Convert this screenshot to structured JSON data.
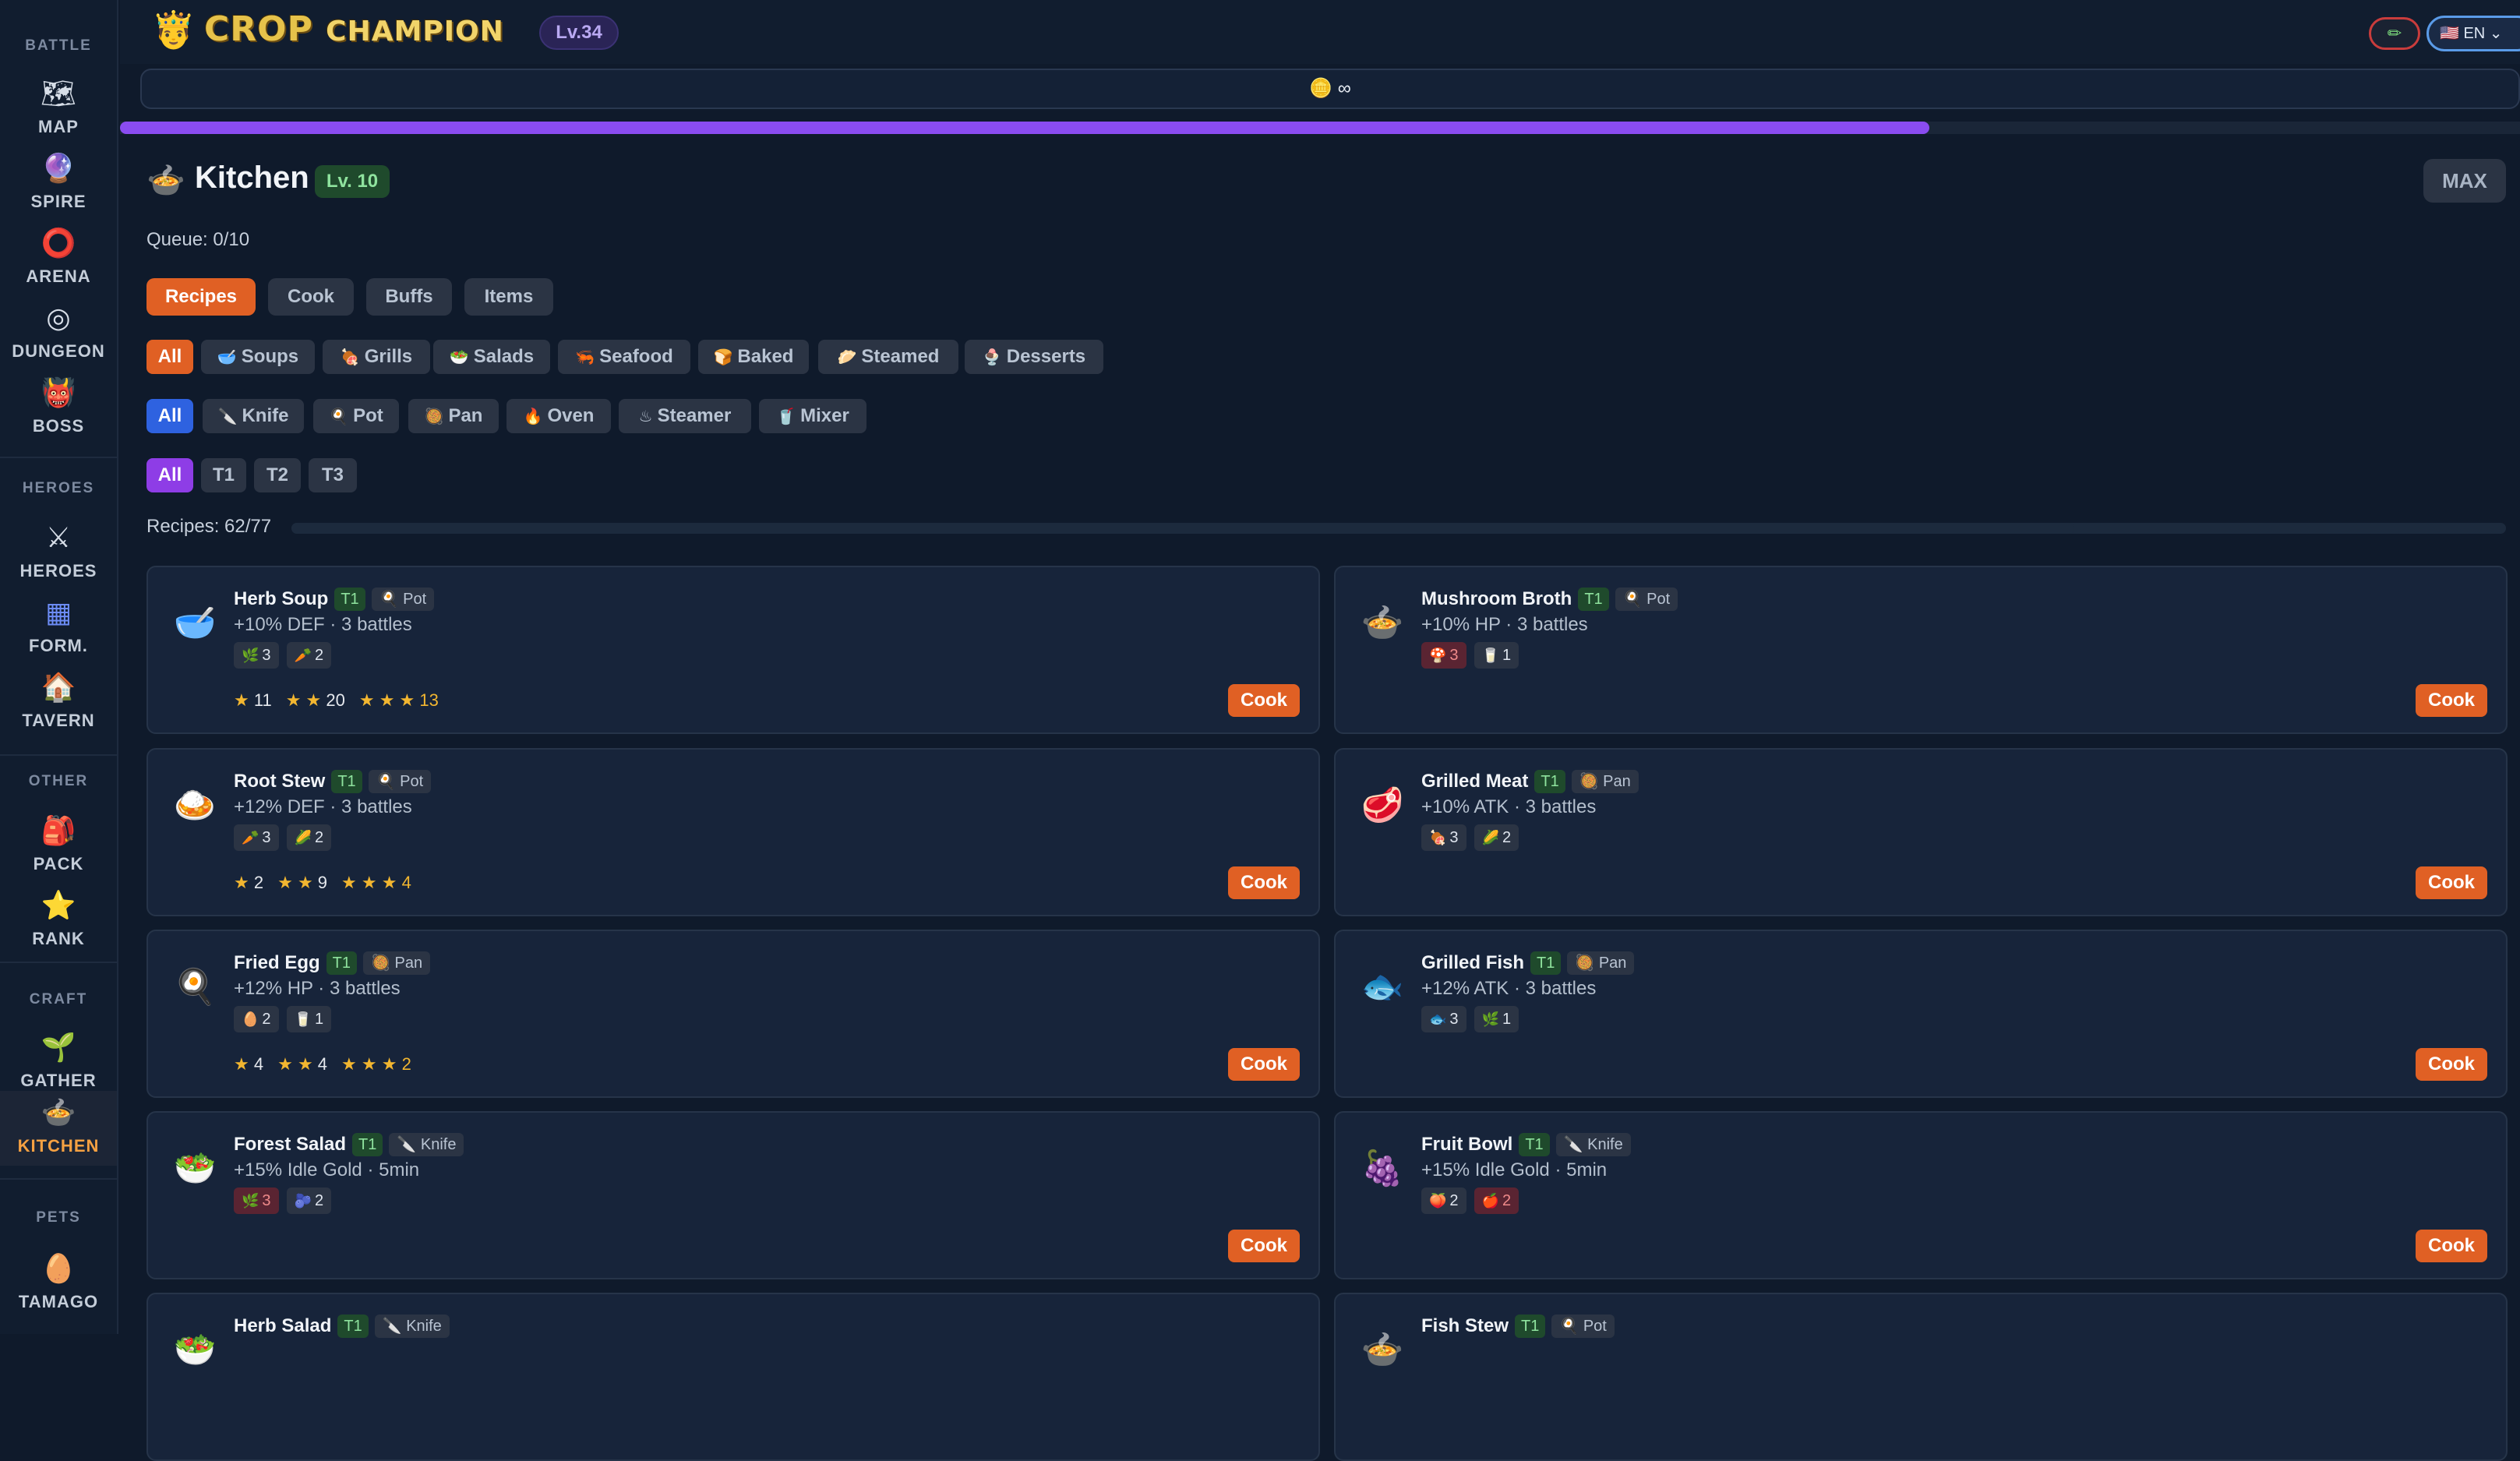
{
  "sidebar": {
    "sections": [
      {
        "heading": "BATTLE",
        "items": [
          {
            "label": "MAP",
            "icon": "🗺"
          },
          {
            "label": "SPIRE",
            "icon": "🔮"
          },
          {
            "label": "ARENA",
            "icon": "⭕"
          },
          {
            "label": "DUNGEON",
            "icon": "◎"
          },
          {
            "label": "BOSS",
            "icon": "👹"
          }
        ]
      },
      {
        "heading": "HEROES",
        "items": [
          {
            "label": "HEROES",
            "icon": "⚔"
          },
          {
            "label": "FORM.",
            "icon": "▦"
          },
          {
            "label": "TAVERN",
            "icon": "🏠"
          }
        ]
      },
      {
        "heading": "OTHER",
        "items": [
          {
            "label": "PACK",
            "icon": "🎒"
          },
          {
            "label": "RANK",
            "icon": "⭐"
          }
        ]
      },
      {
        "heading": "CRAFT",
        "items": [
          {
            "label": "GATHER",
            "icon": "🌱"
          },
          {
            "label": "KITCHEN",
            "icon": "🍲"
          }
        ]
      },
      {
        "heading": "PETS",
        "items": [
          {
            "label": "TAMAGO",
            "icon": "🥚"
          }
        ]
      }
    ]
  },
  "topbar": {
    "avatar_icon": "🤴",
    "title_main": "CROP",
    "title_sub": "CHAMPION",
    "level": "Lv.34",
    "edit_icon": "✏",
    "language": "🇺🇸 EN ⌄",
    "gold_icon": "🪙",
    "gold_value": "∞",
    "xp_progress": 0.754
  },
  "header": {
    "icon": "🍲",
    "title": "Kitchen",
    "level": "Lv. 10",
    "max_label": "MAX",
    "queue": "Queue: 0/10"
  },
  "tabs": [
    "Recipes",
    "Cook",
    "Buffs",
    "Items"
  ],
  "categories": [
    {
      "label": "All",
      "icon": ""
    },
    {
      "label": "Soups",
      "icon": "🥣"
    },
    {
      "label": "Grills",
      "icon": "🍖"
    },
    {
      "label": "Salads",
      "icon": "🥗"
    },
    {
      "label": "Seafood",
      "icon": "🦐"
    },
    {
      "label": "Baked",
      "icon": "🍞"
    },
    {
      "label": "Steamed",
      "icon": "🥟"
    },
    {
      "label": "Desserts",
      "icon": "🍨"
    }
  ],
  "tools": [
    {
      "label": "All",
      "icon": ""
    },
    {
      "label": "Knife",
      "icon": "🔪"
    },
    {
      "label": "Pot",
      "icon": "🍳"
    },
    {
      "label": "Pan",
      "icon": "🥘"
    },
    {
      "label": "Oven",
      "icon": "🔥"
    },
    {
      "label": "Steamer",
      "icon": "♨"
    },
    {
      "label": "Mixer",
      "icon": "🥤"
    }
  ],
  "tiers": [
    "All",
    "T1",
    "T2",
    "T3"
  ],
  "recipes_count": "Recipes: 62/77",
  "recipes_progress": 0.805,
  "cook_label": "Cook",
  "recipes": [
    {
      "name": "Herb Soup",
      "tier": "T1",
      "tool": "🍳 Pot",
      "dish": "🥣",
      "effect": "+10% DEF · 3 battles",
      "ingredients": [
        {
          "icon": "🌿",
          "qty": "3",
          "missing": false
        },
        {
          "icon": "🥕",
          "qty": "2",
          "missing": false
        }
      ],
      "stars": [
        "11",
        "20",
        "13"
      ]
    },
    {
      "name": "Mushroom Broth",
      "tier": "T1",
      "tool": "🍳 Pot",
      "dish": "🍲",
      "effect": "+10% HP · 3 battles",
      "ingredients": [
        {
          "icon": "🍄",
          "qty": "3",
          "missing": true
        },
        {
          "icon": "🥛",
          "qty": "1",
          "missing": false
        }
      ],
      "stars": []
    },
    {
      "name": "Root Stew",
      "tier": "T1",
      "tool": "🍳 Pot",
      "dish": "🍛",
      "effect": "+12% DEF · 3 battles",
      "ingredients": [
        {
          "icon": "🥕",
          "qty": "3",
          "missing": false
        },
        {
          "icon": "🌽",
          "qty": "2",
          "missing": false
        }
      ],
      "stars": [
        "2",
        "9",
        "4"
      ]
    },
    {
      "name": "Grilled Meat",
      "tier": "T1",
      "tool": "🥘 Pan",
      "dish": "🥩",
      "effect": "+10% ATK · 3 battles",
      "ingredients": [
        {
          "icon": "🍖",
          "qty": "3",
          "missing": false
        },
        {
          "icon": "🌽",
          "qty": "2",
          "missing": false
        }
      ],
      "stars": []
    },
    {
      "name": "Fried Egg",
      "tier": "T1",
      "tool": "🥘 Pan",
      "dish": "🍳",
      "effect": "+12% HP · 3 battles",
      "ingredients": [
        {
          "icon": "🥚",
          "qty": "2",
          "missing": false
        },
        {
          "icon": "🥛",
          "qty": "1",
          "missing": false
        }
      ],
      "stars": [
        "4",
        "4",
        "2"
      ]
    },
    {
      "name": "Grilled Fish",
      "tier": "T1",
      "tool": "🥘 Pan",
      "dish": "🐟",
      "effect": "+12% ATK · 3 battles",
      "ingredients": [
        {
          "icon": "🐟",
          "qty": "3",
          "missing": false
        },
        {
          "icon": "🌿",
          "qty": "1",
          "missing": false
        }
      ],
      "stars": []
    },
    {
      "name": "Forest Salad",
      "tier": "T1",
      "tool": "🔪 Knife",
      "dish": "🥗",
      "effect": "+15% Idle Gold · 5min",
      "ingredients": [
        {
          "icon": "🌿",
          "qty": "3",
          "missing": true
        },
        {
          "icon": "🫐",
          "qty": "2",
          "missing": false
        }
      ],
      "stars": []
    },
    {
      "name": "Fruit Bowl",
      "tier": "T1",
      "tool": "🔪 Knife",
      "dish": "🍇",
      "effect": "+15% Idle Gold · 5min",
      "ingredients": [
        {
          "icon": "🍑",
          "qty": "2",
          "missing": false
        },
        {
          "icon": "🍎",
          "qty": "2",
          "missing": true
        }
      ],
      "stars": []
    },
    {
      "name": "Herb Salad",
      "tier": "T1",
      "tool": "🔪 Knife",
      "dish": "🥗",
      "effect": "",
      "ingredients": [],
      "stars": []
    },
    {
      "name": "Fish Stew",
      "tier": "T1",
      "tool": "🍳 Pot",
      "dish": "🍲",
      "effect": "",
      "ingredients": [],
      "stars": []
    }
  ],
  "colors": {
    "accent": "#e06024",
    "tool_active": "#2e62e0",
    "tier_active": "#8e3de6",
    "xp": "#8a4cf0"
  }
}
